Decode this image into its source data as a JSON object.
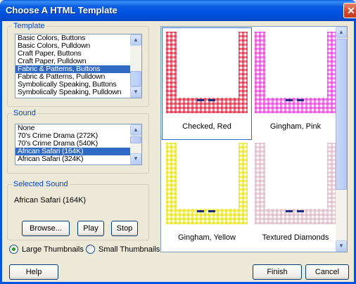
{
  "window": {
    "title": "Choose A HTML Template"
  },
  "template": {
    "label": "Template",
    "items": [
      "Basic Colors, Buttons",
      "Basic Colors, Pulldown",
      "Craft Paper, Buttons",
      "Craft Paper, Pulldown",
      "Fabric & Patterns, Buttons",
      "Fabric & Patterns, Pulldown",
      "Symbolically Speaking, Buttons",
      "Symbolically Speaking, Pulldown"
    ],
    "selected_index": 4
  },
  "sound": {
    "label": "Sound",
    "items": [
      "None",
      "70's Crime Drama (272K)",
      "70's Crime Drama (540K)",
      "African Safari (164K)",
      "African Safari (324K)"
    ],
    "selected_index": 3
  },
  "selected_sound": {
    "label": "Selected Sound",
    "value": "African Safari (164K)",
    "browse_label": "Browse...",
    "play_label": "Play",
    "stop_label": "Stop"
  },
  "thumbnail_mode": {
    "large_label": "Large Thumbnails",
    "small_label": "Small Thumbnails",
    "selected": "large"
  },
  "thumbnails": [
    {
      "caption": "Checked, Red",
      "color": "#d8223a",
      "selected": true
    },
    {
      "caption": "Gingham, Pink",
      "color": "#e23ad8",
      "selected": false
    },
    {
      "caption": "Gingham, Yellow",
      "color": "#e6e21a",
      "selected": false
    },
    {
      "caption": "Textured Diamonds",
      "color": "#d9b6c2",
      "selected": false
    }
  ],
  "footer": {
    "help_label": "Help",
    "finish_label": "Finish",
    "cancel_label": "Cancel"
  }
}
